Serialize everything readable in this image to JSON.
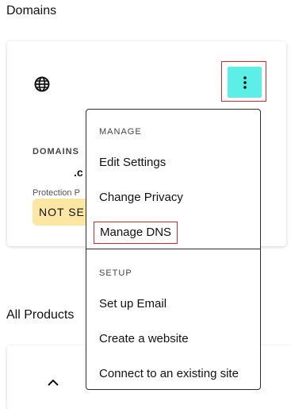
{
  "section_title": "Domains",
  "domain_card": {
    "globe_icon": "globe-icon",
    "kebab_icon": "kebab-vertical-icon",
    "kebab_color": "#5eeee8",
    "domains_label": "DOMAINS",
    "domain_name": ".c",
    "protection_label": "Protection P",
    "status_badge": "NOT SE",
    "status_badge_color": "#fbe7a3"
  },
  "menu": {
    "manage_heading": "MANAGE",
    "items_manage": [
      "Edit Settings",
      "Change Privacy",
      "Manage DNS"
    ],
    "setup_heading": "SETUP",
    "items_setup": [
      "Set up Email",
      "Create a website",
      "Connect to an existing site"
    ]
  },
  "all_products_title": "All Products",
  "product_card": {
    "chevron_icon": "chevron-up-icon"
  },
  "colors": {
    "highlight_border": "#d02a2a",
    "menu_border": "#2b2b2b"
  }
}
